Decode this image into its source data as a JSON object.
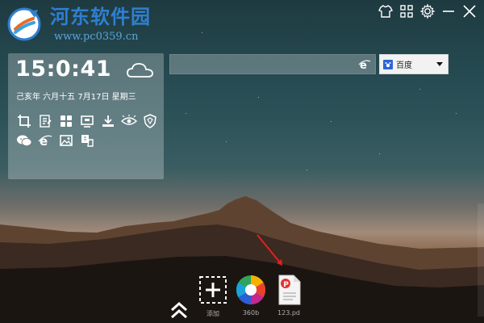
{
  "logo": {
    "title": "河东软件园",
    "url": "www.pc0359.cn"
  },
  "top_controls": {
    "skin_icon": "shirt-icon",
    "apps_icon": "grid-icon",
    "settings_icon": "gear-icon",
    "minimize_icon": "minimize-icon",
    "close_icon": "close-icon"
  },
  "widget": {
    "time": "15:0:41",
    "date_line": "己亥年 六月十五 7月17日 星期三",
    "weather_icon": "cloud-icon",
    "tools_row1": [
      "crop-icon",
      "notes-icon",
      "apps-icon",
      "screen-icon",
      "download-icon",
      "eye-icon",
      "shield-icon"
    ],
    "tools_row2": [
      "wechat-icon",
      "ie-icon",
      "image-icon",
      "translate-icon"
    ]
  },
  "search": {
    "value": "",
    "ie_icon": "ie-icon"
  },
  "engine": {
    "label": "百度",
    "icon": "baidu-icon"
  },
  "dock": {
    "items": [
      {
        "label": "添加",
        "icon": "add-icon"
      },
      {
        "label": "360b",
        "icon": "360-browser-icon"
      },
      {
        "label": "123.pd",
        "icon": "pdf-file-icon"
      }
    ],
    "collapse_icon": "double-chevron-up-icon"
  },
  "colors": {
    "logo_blue": "#2f7fd1",
    "widget_bg": "rgba(255,255,255,0.26)",
    "arrow_red": "#e02121"
  }
}
